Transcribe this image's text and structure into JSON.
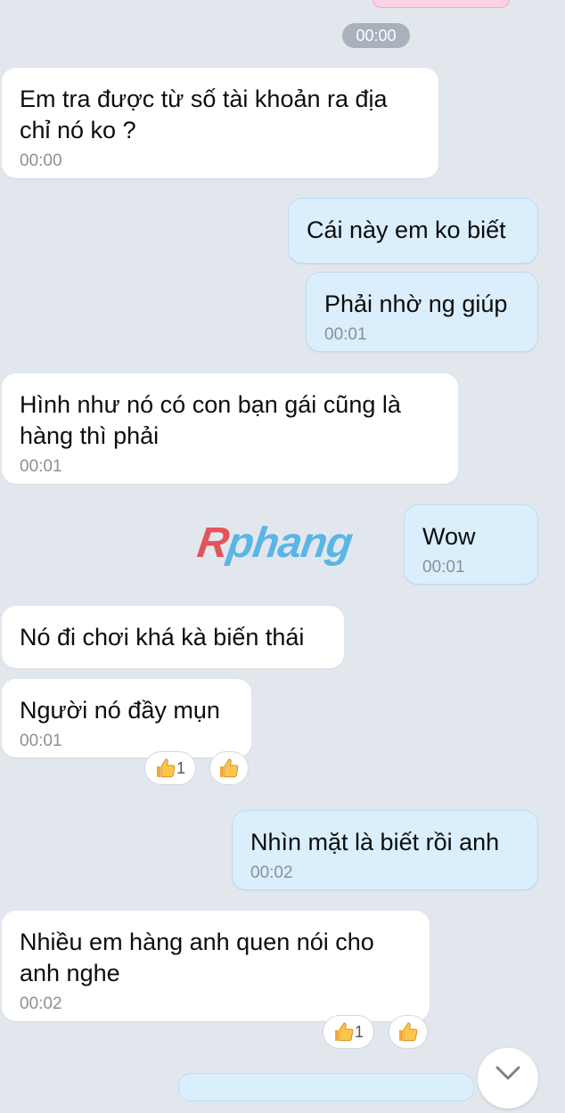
{
  "top_timestamp": "00:00",
  "messages": [
    {
      "text": "Em tra được từ số tài khoản ra địa chỉ nó ko ?",
      "time": "00:00"
    },
    {
      "text": "Cái này em ko biết"
    },
    {
      "text": "Phải nhờ ng giúp",
      "time": "00:01"
    },
    {
      "text": "Hình như nó có con bạn gái cũng là hàng thì phải",
      "time": "00:01"
    },
    {
      "text": "Wow",
      "time": "00:01"
    },
    {
      "text": "Nó đi chơi khá kà biến thái"
    },
    {
      "text": "Người nó đầy mụn",
      "time": "00:01",
      "reaction_count": "1"
    },
    {
      "text": "Nhìn mặt là biết rồi anh",
      "time": "00:02"
    },
    {
      "text": "Nhiều em hàng anh quen nói cho anh nghe",
      "time": "00:02",
      "reaction_count": "1"
    }
  ],
  "watermark": {
    "part1": "R",
    "part2": "phang"
  },
  "icons": {
    "reaction": "thumbs-up-icon",
    "scroll": "chevron-down-icon"
  },
  "colors": {
    "background": "#e2e7ee",
    "incoming": "#ffffff",
    "outgoing": "#dbeefc",
    "timestamp": "#8a9099"
  }
}
